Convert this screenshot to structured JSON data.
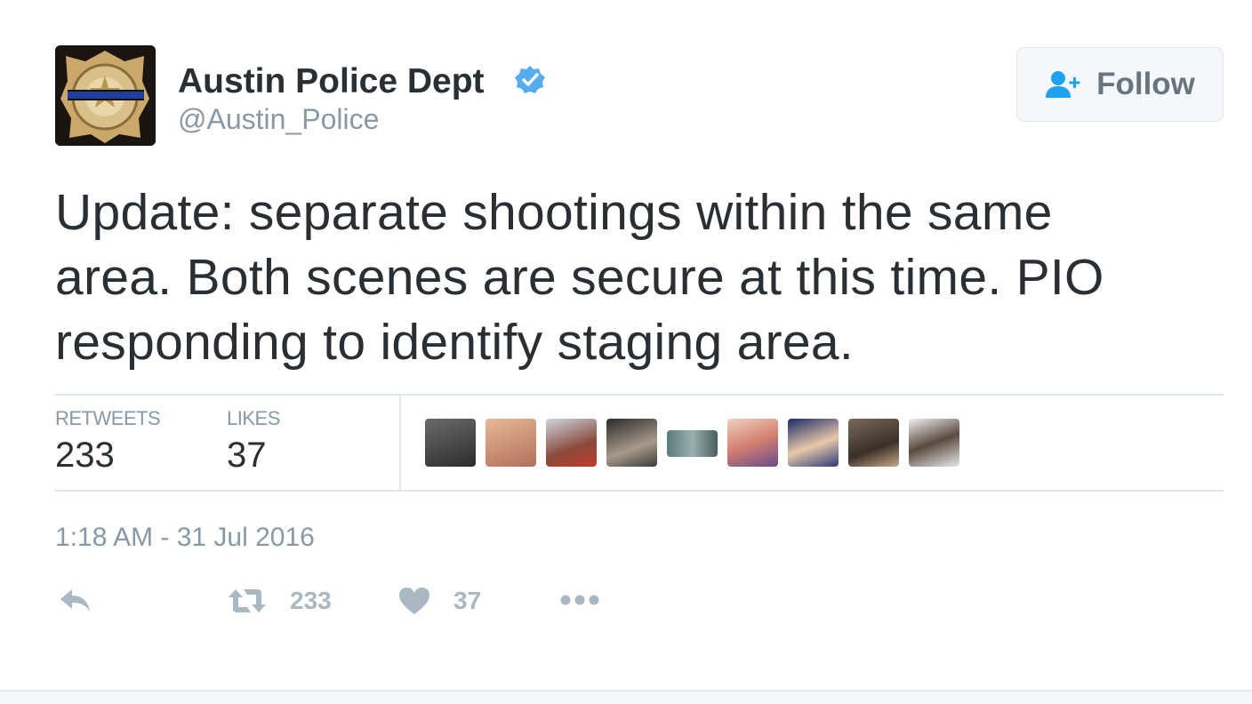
{
  "tweet": {
    "author": {
      "name": "Austin Police Dept",
      "handle": "@Austin_Police",
      "verified": true,
      "avatar_icon": "police-badge-avatar"
    },
    "follow_label": "Follow",
    "text_lines": [
      "Update: separate shootings within the same",
      "area. Both scenes are secure at this time. PIO",
      "responding to identify staging area."
    ],
    "stats": {
      "retweets_label": "RETWEETS",
      "retweets_value": "233",
      "likes_label": "LIKES",
      "likes_value": "37"
    },
    "liker_avatars_count": 9,
    "timestamp": "1:18 AM - 31 Jul 2016",
    "actions": {
      "retweet_count": "233",
      "like_count": "37"
    }
  },
  "colors": {
    "text": "#292f33",
    "muted": "#8899a6",
    "verified": "#55acee",
    "action_gray": "#aab8c2",
    "button_bg": "#f5f8fa",
    "border": "#e1e8ed"
  }
}
